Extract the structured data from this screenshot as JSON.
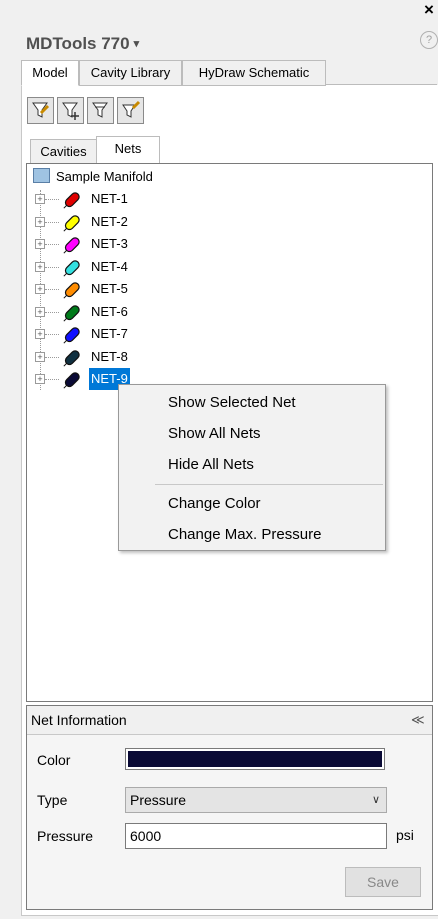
{
  "window": {
    "close_glyph": "×",
    "title": "MDTools 770",
    "title_chevron": "▾",
    "help_glyph": "?"
  },
  "top_tabs": [
    {
      "label": "Model",
      "active": true
    },
    {
      "label": "Cavity Library",
      "active": false
    },
    {
      "label": "HyDraw Schematic",
      "active": false
    }
  ],
  "toolbar": {
    "buttons": [
      "edit-cavity-icon",
      "move-cavity-icon",
      "filter-cavity-icon",
      "paint-cavity-icon"
    ]
  },
  "sub_tabs": [
    {
      "label": "Cavities",
      "active": false
    },
    {
      "label": "Nets",
      "active": true
    }
  ],
  "tree": {
    "root": "Sample Manifold",
    "nets": [
      {
        "label": "NET-1",
        "color": "#e00000",
        "selected": false
      },
      {
        "label": "NET-2",
        "color": "#ffff00",
        "selected": false
      },
      {
        "label": "NET-3",
        "color": "#ff00ff",
        "selected": false
      },
      {
        "label": "NET-4",
        "color": "#33e0e0",
        "selected": false
      },
      {
        "label": "NET-5",
        "color": "#ff8c00",
        "selected": false
      },
      {
        "label": "NET-6",
        "color": "#007a1a",
        "selected": false
      },
      {
        "label": "NET-7",
        "color": "#1010ff",
        "selected": false
      },
      {
        "label": "NET-8",
        "color": "#103040",
        "selected": false
      },
      {
        "label": "NET-9",
        "color": "#0a0a35",
        "selected": true
      }
    ]
  },
  "context_menu": {
    "items": [
      "Show Selected Net",
      "Show All Nets",
      "Hide All Nets",
      "Change Color",
      "Change Max. Pressure"
    ]
  },
  "net_info": {
    "title": "Net Information",
    "collapse_glyph": "≪",
    "color_label": "Color",
    "color_value": "#0a0a35",
    "type_label": "Type",
    "type_value": "Pressure",
    "type_arrow": "∨",
    "pressure_label": "Pressure",
    "pressure_value": "6000",
    "pressure_unit": "psi",
    "save_label": "Save"
  }
}
